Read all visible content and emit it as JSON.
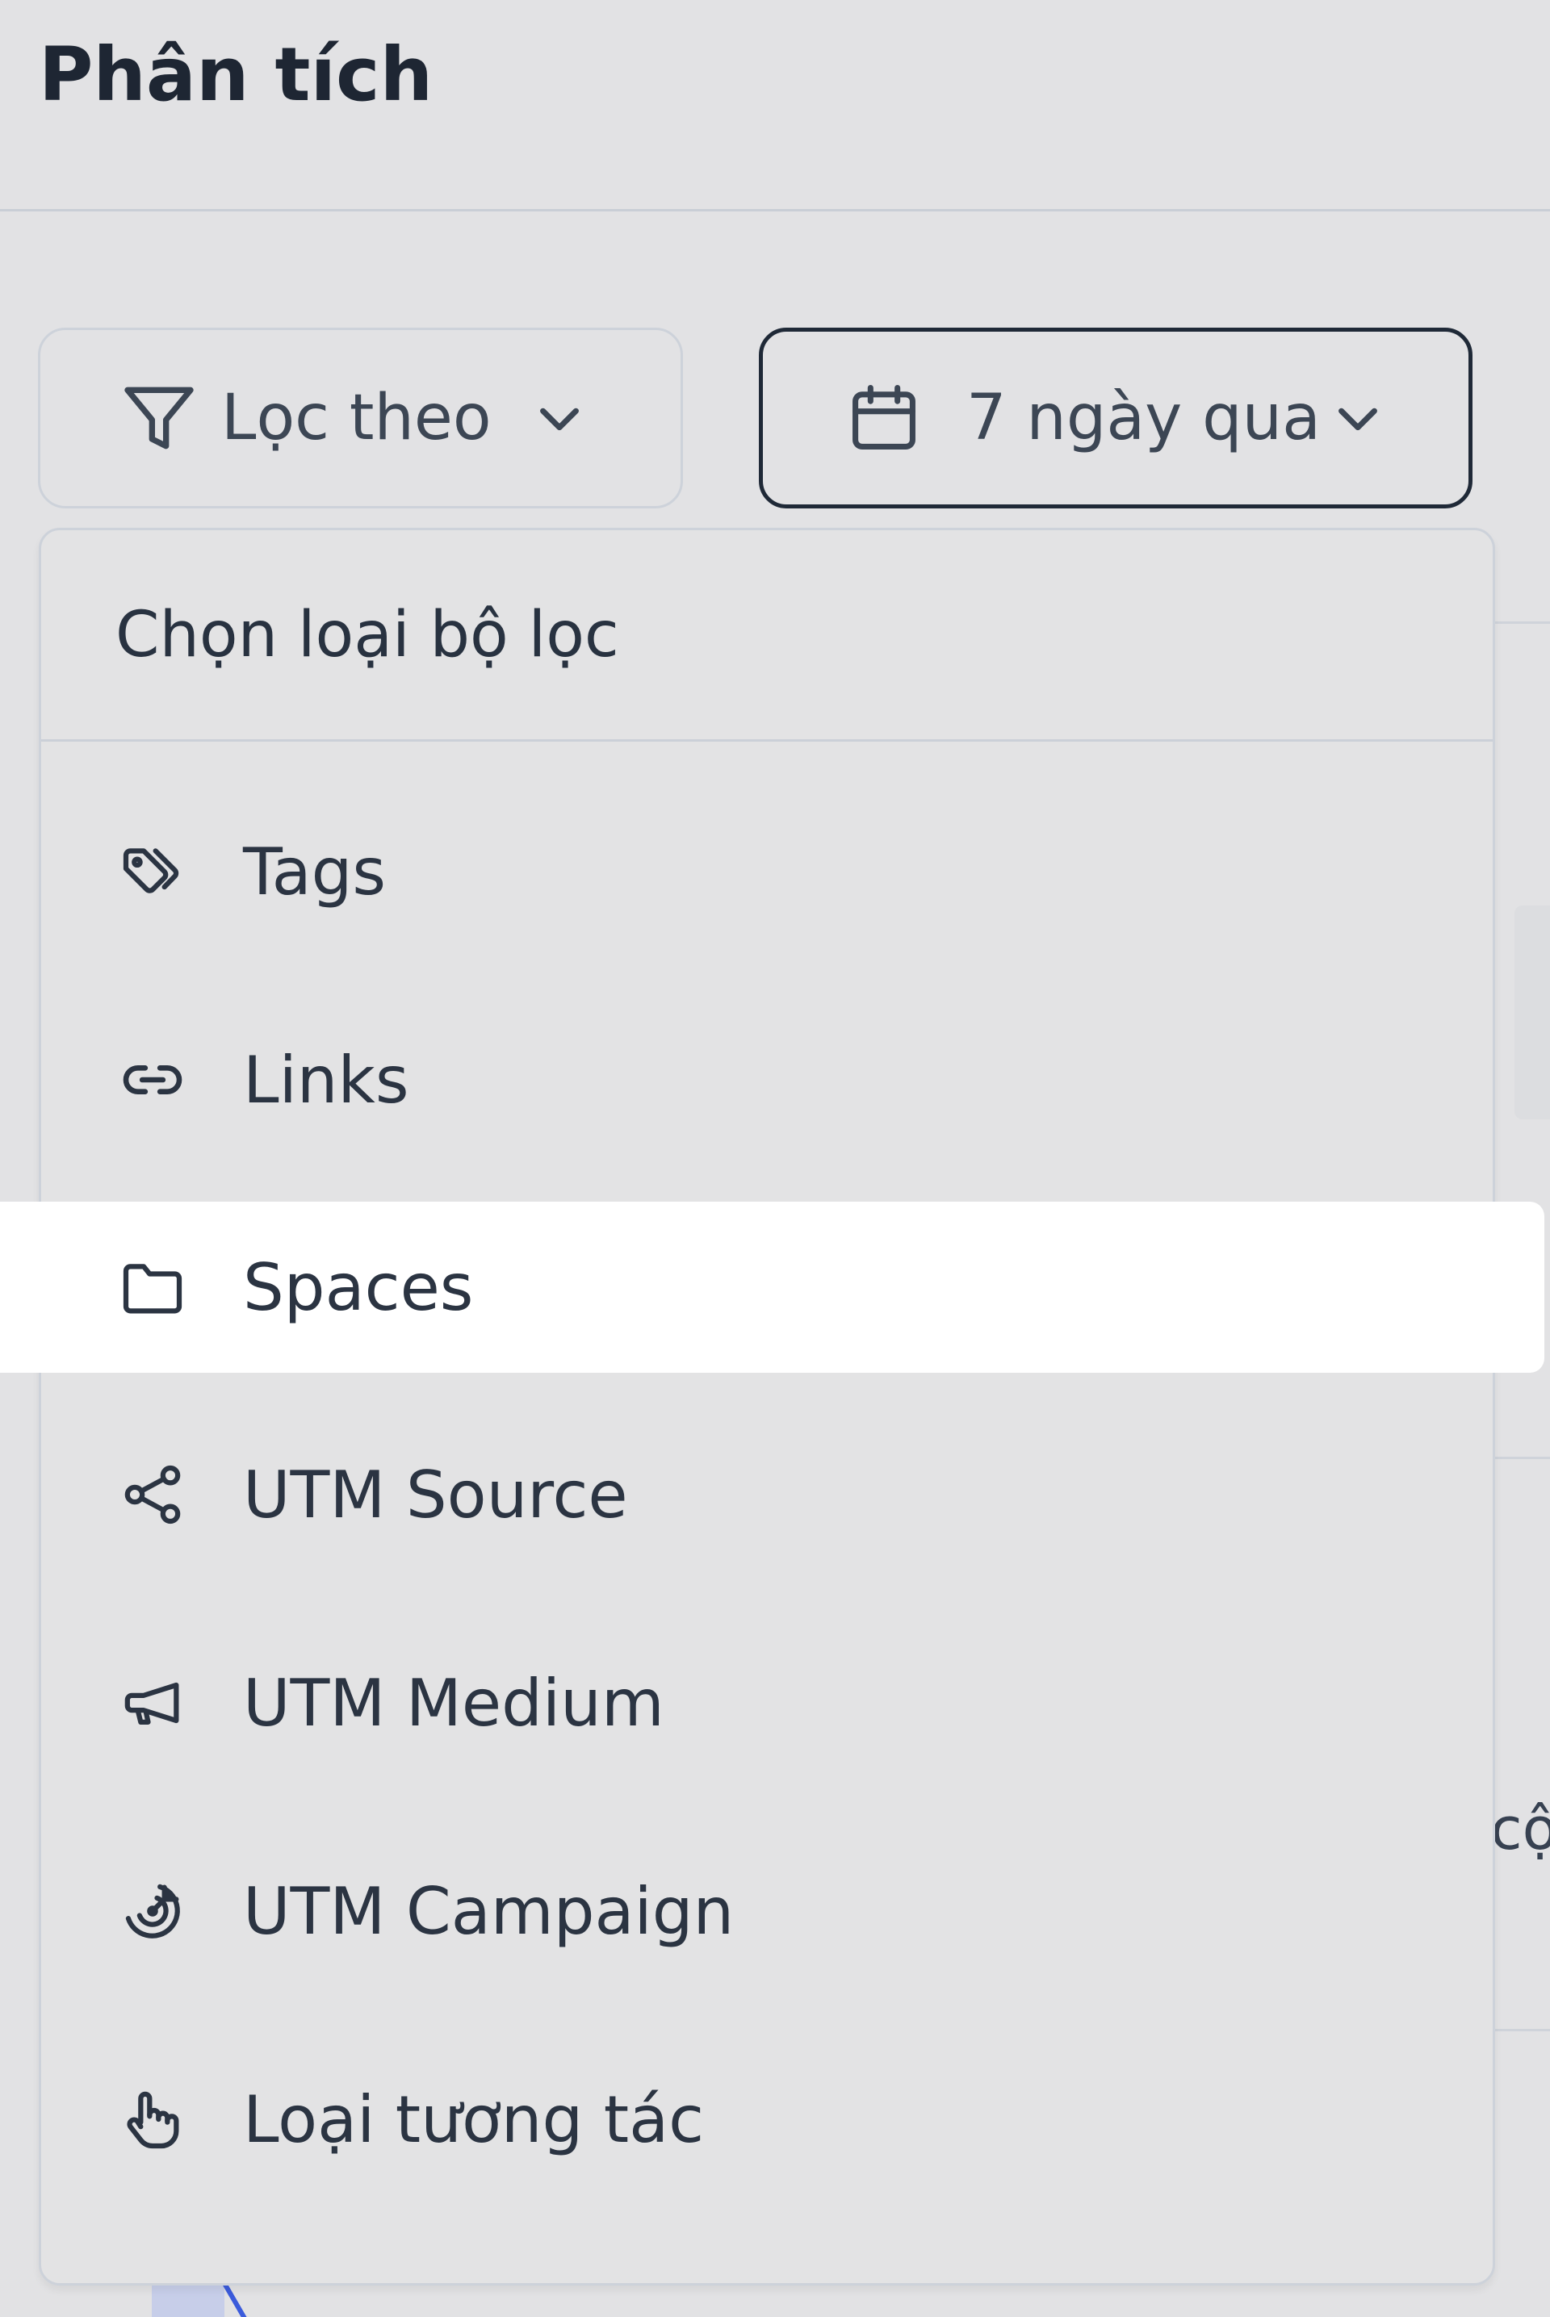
{
  "header": {
    "title": "Phân tích"
  },
  "filter_button": {
    "label": "Lọc theo",
    "icon": "funnel-icon"
  },
  "date_button": {
    "label": "7 ngày qua",
    "icon": "calendar-icon"
  },
  "dropdown": {
    "title": "Chọn loại bộ lọc",
    "items": [
      {
        "label": "Tags",
        "icon": "tags-icon"
      },
      {
        "label": "Links",
        "icon": "link-icon"
      },
      {
        "label": "Spaces",
        "icon": "folder-icon",
        "highlighted": true
      },
      {
        "label": "UTM Source",
        "icon": "share-icon"
      },
      {
        "label": "UTM Medium",
        "icon": "megaphone-icon"
      },
      {
        "label": "UTM Campaign",
        "icon": "target-icon"
      },
      {
        "label": "Loại tương tác",
        "icon": "pointer-hand-icon"
      }
    ]
  },
  "background": {
    "partial_text": "cộ"
  },
  "colors": {
    "page_bg": "#e2e2e4",
    "highlight_bg": "#ffffff",
    "text": "#2b3442",
    "accent_blue": "#3b5bdb"
  }
}
